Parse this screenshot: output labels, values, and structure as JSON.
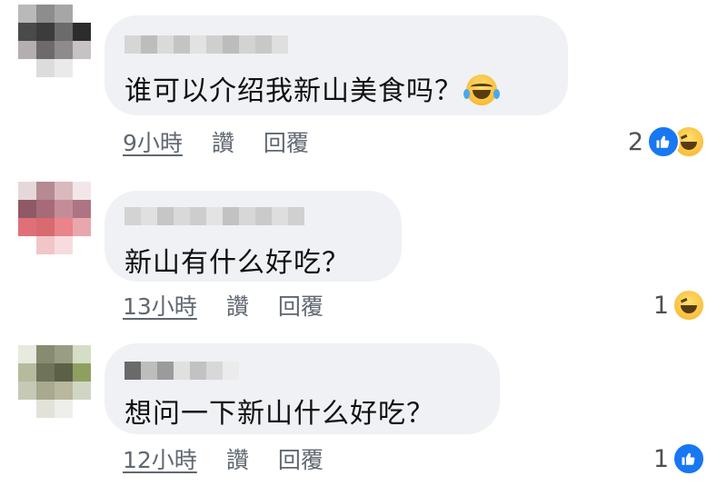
{
  "comments": [
    {
      "text": "谁可以介绍我新山美食吗？",
      "emoji": "face-with-tears-of-joy",
      "time": "9小時",
      "like_label": "讚",
      "reply_label": "回覆",
      "reaction_count": "2",
      "reactions": [
        "like",
        "haha"
      ]
    },
    {
      "text": "新山有什么好吃？",
      "time": "13小時",
      "like_label": "讚",
      "reply_label": "回覆",
      "reaction_count": "1",
      "reactions": [
        "haha"
      ]
    },
    {
      "text": "想问一下新山什么好吃？",
      "time": "12小時",
      "like_label": "讚",
      "reply_label": "回覆",
      "reaction_count": "1",
      "reactions": [
        "like"
      ]
    }
  ],
  "colors": {
    "bubble": "#eff1f4",
    "meta_text": "#606770",
    "like_blue": "#1877f2",
    "haha_yellow": "#f7b125"
  }
}
